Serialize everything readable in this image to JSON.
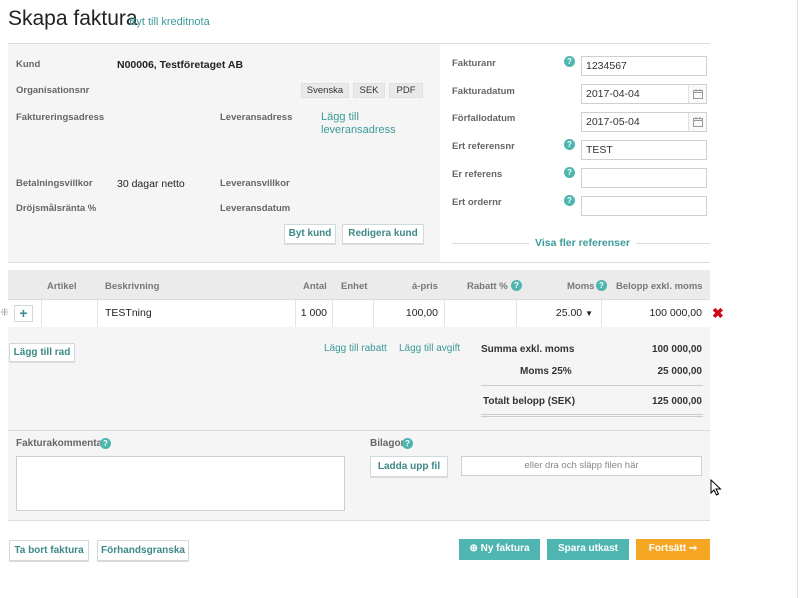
{
  "header": {
    "title": "Skapa faktura",
    "switch_link": "Byt till kreditnota"
  },
  "customer": {
    "kund_label": "Kund",
    "kund_value": "N00006, Testföretaget AB",
    "org_label": "Organisationsnr",
    "lang_pill": "Svenska",
    "currency_pill": "SEK",
    "format_pill": "PDF",
    "billing_address_label": "Faktureringsadress",
    "delivery_address_label": "Leveransadress",
    "add_delivery_link": "Lägg till leveransadress",
    "payment_terms_label": "Betalningsvillkor",
    "payment_terms_value": "30 dagar netto",
    "delivery_terms_label": "Leveransvillkor",
    "late_interest_label": "Dröjsmålsränta %",
    "delivery_date_label": "Leveransdatum",
    "change_customer_btn": "Byt kund",
    "edit_customer_btn": "Redigera kund"
  },
  "invoice": {
    "number_label": "Fakturanr",
    "number_value": "1234567",
    "date_label": "Fakturadatum",
    "date_value": "2017-04-04",
    "due_label": "Förfallodatum",
    "due_value": "2017-05-04",
    "your_ref_no_label": "Ert referensnr",
    "your_ref_no_value": "TEST",
    "our_ref_label": "Er referens",
    "order_no_label": "Ert ordernr",
    "more_refs_link": "Visa fler referenser"
  },
  "table": {
    "headers": {
      "article": "Artikel",
      "description": "Beskrivning",
      "qty": "Antal",
      "unit": "Enhet",
      "price": "á-pris",
      "discount": "Rabatt %",
      "vat": "Moms",
      "amount": "Belopp exkl. moms"
    },
    "rows": [
      {
        "article": "",
        "description": "TESTning",
        "qty": "1 000",
        "unit": "",
        "price": "100,00",
        "discount": "",
        "vat": "25.00",
        "amount": "100 000,00"
      }
    ],
    "add_row_btn": "Lägg till rad",
    "add_discount_link": "Lägg till rabatt",
    "add_fee_link": "Lägg till avgift"
  },
  "summary": {
    "subtotal_label": "Summa exkl. moms",
    "subtotal_value": "100 000,00",
    "vat_label": "Moms  25%",
    "vat_value": "25 000,00",
    "total_label": "Totalt belopp (SEK)",
    "total_value": "125 000,00"
  },
  "comment": {
    "label": "Fakturakommentar"
  },
  "attachments": {
    "label": "Bilagor",
    "upload_btn": "Ladda upp fil",
    "drop_text": "eller dra och släpp filen här"
  },
  "footer": {
    "delete_btn": "Ta bort faktura",
    "preview_btn": "Förhandsgranska",
    "new_btn": "Ny faktura",
    "draft_btn": "Spara utkast",
    "continue_btn": "Fortsätt"
  },
  "colors": {
    "accent": "#4fb5b0",
    "orange": "#f5a623",
    "delete": "#d0021b"
  }
}
